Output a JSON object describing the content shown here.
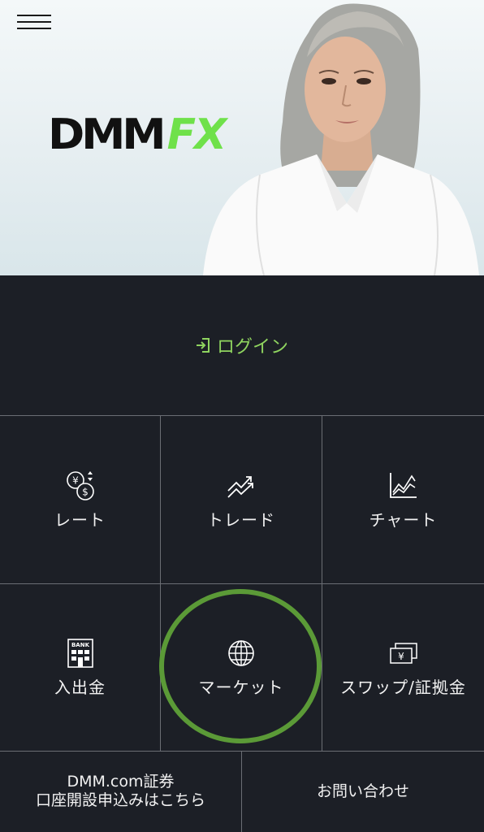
{
  "header": {
    "logo": {
      "part1": "DMM",
      "part2": "FX"
    }
  },
  "login": {
    "label": "ログイン"
  },
  "menu": [
    {
      "label": "レート",
      "icon": "currency-exchange-icon"
    },
    {
      "label": "トレード",
      "icon": "trend-arrows-icon"
    },
    {
      "label": "チャート",
      "icon": "chart-icon"
    },
    {
      "label": "入出金",
      "icon": "bank-icon"
    },
    {
      "label": "マーケット",
      "icon": "globe-icon"
    },
    {
      "label": "スワップ/証拠金",
      "icon": "banknotes-icon"
    }
  ],
  "footer": {
    "securities_line1": "DMM.com証券",
    "securities_line2": "口座開設申込みはこちら",
    "contact": "お問い合わせ"
  },
  "colors": {
    "background": "#1c1f26",
    "accent_green": "#8fd45f",
    "logo_green": "#6fe14a",
    "highlight_circle": "#5b9a37"
  }
}
